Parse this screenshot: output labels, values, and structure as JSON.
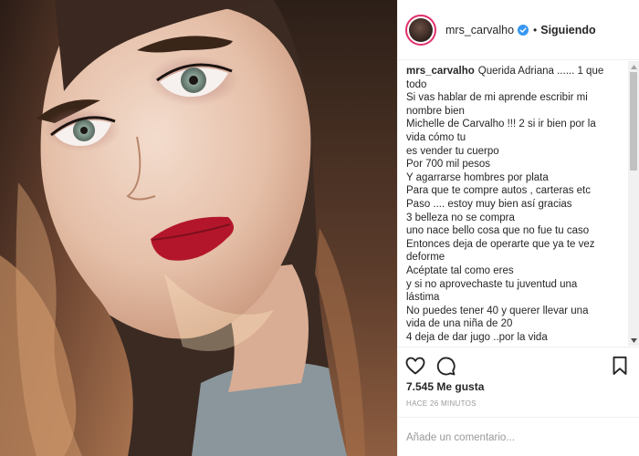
{
  "post": {
    "username": "mrs_carvalho",
    "separator": "•",
    "follow_status": "Siguiendo"
  },
  "caption": {
    "username": "mrs_carvalho",
    "lines": [
      "Querida Adriana ...... 1 que",
      "todo",
      "Si vas hablar de mi aprende escribir mi",
      "nombre bien",
      "Michelle de Carvalho !!! 2 si ir bien por la",
      "vida cómo tu",
      "es vender tu cuerpo",
      "Por 700 mil pesos",
      "Y agarrarse hombres por plata",
      "Para que te compre autos , carteras etc",
      "Paso .... estoy muy bien así gracias",
      "3 belleza no se compra",
      "uno nace bello cosa que no fue tu caso",
      "Entonces deja de operarte que ya te vez",
      "deforme",
      "Acéptate tal como eres",
      "y si no aprovechaste tu juventud una",
      "lástima",
      "No puedes tener 40 y querer llevar una",
      "vida de una niña de 20",
      "4 deja de dar jugo ..por la vida"
    ]
  },
  "stats": {
    "likes": "7.545 Me gusta",
    "timestamp": "HACE 26 MINUTOS"
  },
  "comment": {
    "placeholder": "Añade un comentario..."
  },
  "icons": {
    "like": "heart-icon",
    "comment": "comment-bubble-icon",
    "save": "bookmark-icon",
    "verified": "verified-badge-icon"
  },
  "colors": {
    "verified": "#3897f0",
    "text": "#262626",
    "muted": "#999999",
    "border": "#efefef",
    "lips": "#b3162a"
  }
}
